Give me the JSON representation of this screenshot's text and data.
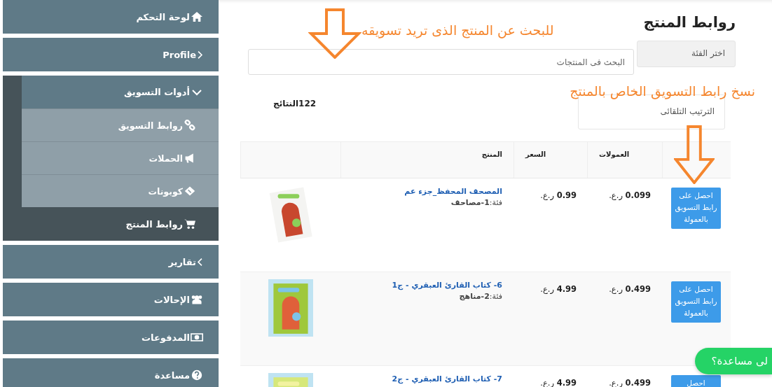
{
  "sidebar": {
    "items": [
      {
        "label": "لوحة التحكم",
        "selected": false
      },
      {
        "label": "Profile",
        "selected": false
      },
      {
        "label": "أدوات التسويق",
        "expanded": true,
        "children": [
          {
            "label": "روابط التسويق",
            "selected": false
          },
          {
            "label": "الحملات",
            "selected": false
          },
          {
            "label": "كوبونات",
            "selected": false
          }
        ]
      },
      {
        "label": "روابط المنتج",
        "selected": true
      },
      {
        "label": "تقارير",
        "selected": false
      },
      {
        "label": "الإحالات",
        "selected": false
      },
      {
        "label": "المدفوعات",
        "selected": false
      },
      {
        "label": "مساعدة",
        "selected": false
      }
    ]
  },
  "page": {
    "title": "روابط المنتج",
    "category_select": {
      "placeholder": "اختر الفئة"
    },
    "search": {
      "placeholder": "البحث فى المنتجات"
    },
    "results": "122النتائج",
    "sort_select": {
      "value": "الترتيب التلقائى"
    }
  },
  "annotations": [
    {
      "text": "للبحث عن المنتج الذى تريد تسويقه",
      "kind": "search"
    },
    {
      "text": "نسخ رابط التسويق الخاص بالمنتج",
      "kind": "copy"
    }
  ],
  "table": {
    "columns": {
      "commission": "العمولات",
      "price": "السعر",
      "product": "المنتج"
    },
    "rows": [
      {
        "button": "احصل على رابط التسويق بالعمولة",
        "commission": "**0.099** ر.ع.",
        "price": "**0.99** ر.ع.",
        "name": "المصحف المحفظ_جزء عم",
        "category": "فئة:**1-مصاحف**"
      },
      {
        "button": "احصل على رابط التسويق بالعمولة",
        "commission": "**0.499** ر.ع.",
        "price": "**4.99** ر.ع.",
        "name": "6- كتاب القارئ العبقري - ج1",
        "category": "فئة:**2-مناهج**"
      },
      {
        "button": "احصل",
        "commission": "**0.499** ر.ع.",
        "price": "**4.99** ر.ع.",
        "name": "7- كتاب القارئ العبقري - ج2"
      }
    ]
  },
  "chat": {
    "label": "لى مساعدة؟"
  }
}
